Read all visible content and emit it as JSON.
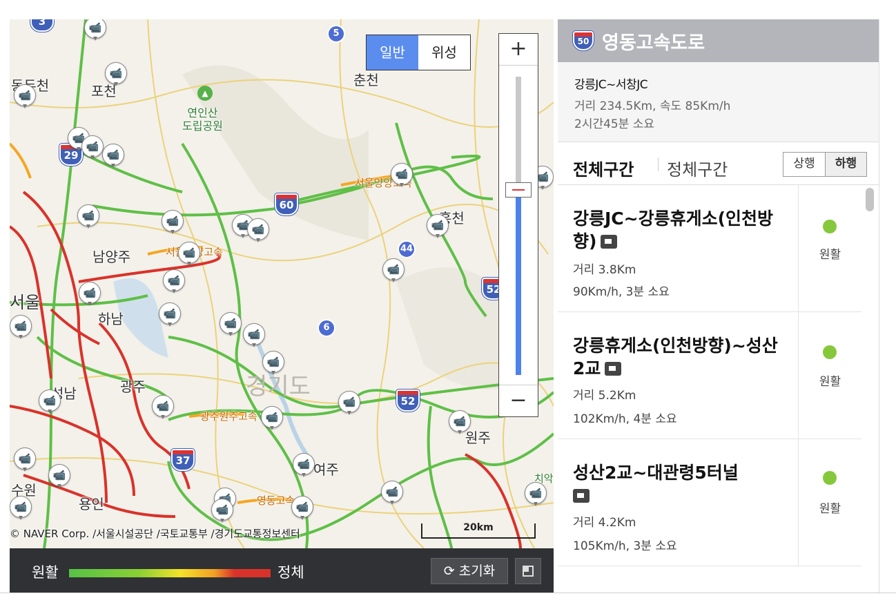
{
  "map": {
    "type_normal": "일반",
    "type_satellite": "위성",
    "zoom_in": "+",
    "zoom_out": "−",
    "zoom_level_fraction": 0.62,
    "copyright": "© NAVER Corp. /서울시설공단 /국토교통부 /경기도교통정보센터",
    "scale": "20km",
    "places": {
      "dongducheon": "동두천",
      "pocheon": "포천",
      "chuncheon": "춘천",
      "yeoninsan": "연인산\n도립공원",
      "namyangju": "남양주",
      "hongcheon": "홍천",
      "seoul": "서울",
      "hanam": "하남",
      "gyeonggi": "경기도",
      "seongnam": "성남",
      "gwangju": "광주",
      "wonju": "원주",
      "yeoju": "여주",
      "suwon": "수원",
      "yongin": "용인",
      "chiak": "치악"
    },
    "road_labels": {
      "seoulyang1": "서울양양고속",
      "seoulyang2": "서울양양고속",
      "gwangjuwonju": "광주원주고속",
      "yeongdong": "영동고속"
    },
    "routes": {
      "r3": "3",
      "r5": "5",
      "r29": "29",
      "r60": "60",
      "r44": "44",
      "r6": "6",
      "r52": "52",
      "r37": "37",
      "r52b": "52"
    }
  },
  "legend": {
    "smooth": "원활",
    "congested": "정체",
    "reset": "초기화",
    "reset_icon": "refresh-icon"
  },
  "panel": {
    "route_number": "50",
    "title": "영동고속도로",
    "section": "강릉JC~서창JC",
    "distance_speed": "거리 234.5Km, 속도 85Km/h",
    "duration": "2시간45분 소요",
    "tab_all": "전체구간",
    "tab_congested": "정체구간",
    "dir_up": "상행",
    "dir_down": "하행"
  },
  "segments": [
    {
      "name": "강릉JC~강릉휴게소(인천방향)",
      "distance": "거리 3.8Km",
      "speed": "90Km/h, 3분 소요",
      "status": "원활"
    },
    {
      "name": "강릉휴게소(인천방향)~성산2교",
      "distance": "거리 5.2Km",
      "speed": "102Km/h, 4분 소요",
      "status": "원활"
    },
    {
      "name": "성산2교~대관령5터널",
      "distance": "거리 4.2Km",
      "speed": "105Km/h, 3분 소요",
      "status": "원활"
    }
  ],
  "colors": {
    "smooth": "#86c83c",
    "slow": "#f5a623",
    "jam": "#d9322a",
    "accent": "#5b8def"
  }
}
